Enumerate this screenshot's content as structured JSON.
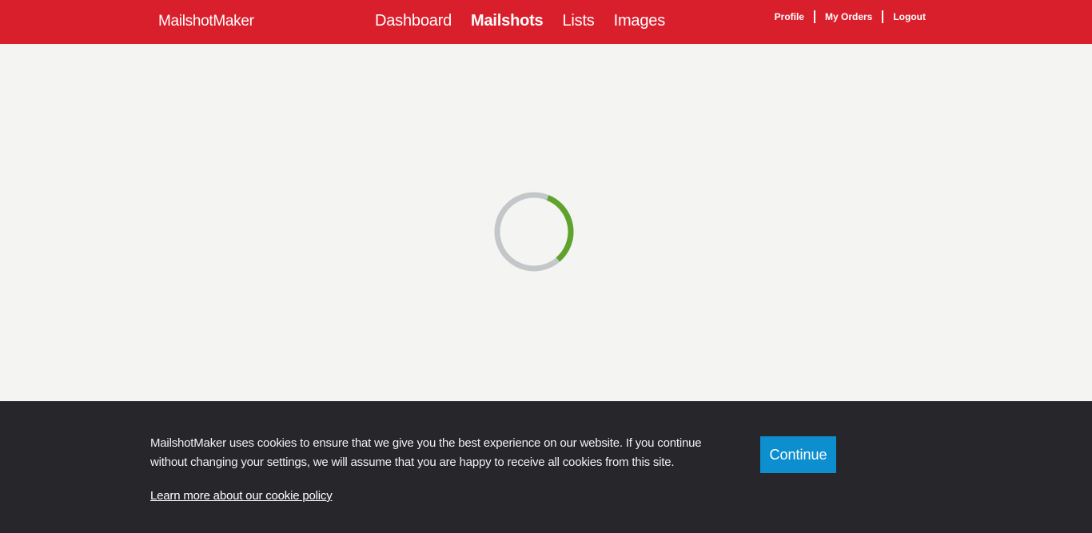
{
  "header": {
    "logo_prefix": "Mailshot",
    "logo_suffix": "Maker",
    "nav": [
      {
        "label": "Dashboard",
        "active": false
      },
      {
        "label": "Mailshots",
        "active": true
      },
      {
        "label": "Lists",
        "active": false
      },
      {
        "label": "Images",
        "active": false
      }
    ],
    "account": {
      "profile": "Profile",
      "orders": "My Orders",
      "logout": "Logout"
    }
  },
  "loading": {
    "icon": "loading-spinner-icon",
    "track_color": "#c4c7c9",
    "progress_color": "#5fa32d"
  },
  "cookie_banner": {
    "message": "MailshotMaker uses cookies to ensure that we give you the best experience on our website. If you continue without changing your settings, we will assume that you are happy to receive all cookies from this site.",
    "link": "Learn more about our cookie policy",
    "button": "Continue"
  },
  "colors": {
    "brand_red": "#da1f2c",
    "banner_bg": "#26262b",
    "button_blue": "#0d8ecf",
    "page_bg": "#f4f4f2"
  }
}
